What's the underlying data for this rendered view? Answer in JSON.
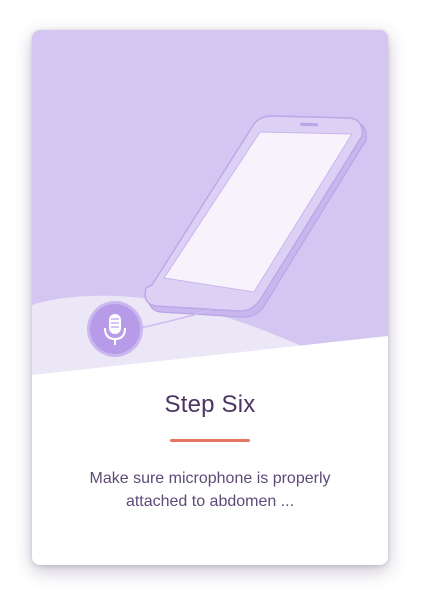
{
  "step": {
    "title": "Step Six",
    "description_line1": "Make sure microphone is properly",
    "description_line2": "attached to abdomen ..."
  },
  "icons": {
    "microphone": "microphone-icon",
    "phone": "smartphone-illustration"
  },
  "colors": {
    "background_top": "#d4c6f2",
    "hill": "#ece7f6",
    "phone_body": "#d8cbf3",
    "phone_screen": "#f7f3fd",
    "phone_outline": "#b9a5e6",
    "mic_badge": "#b79be8",
    "accent_divider": "#e87466",
    "title_text": "#4a3560",
    "body_text": "#5e4a78"
  }
}
